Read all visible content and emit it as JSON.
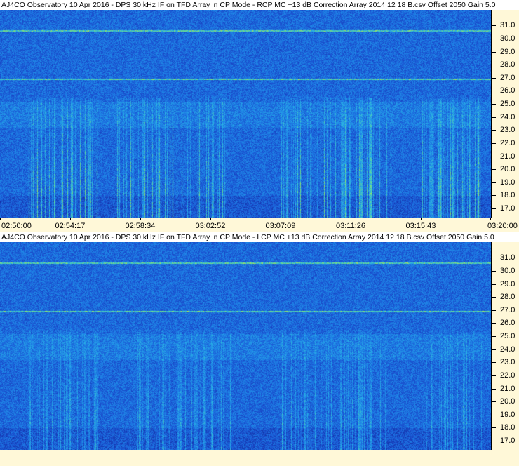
{
  "chart_data": [
    {
      "type": "heatmap",
      "title": "AJ4CO Observatory 10 Apr 2016 - DPS 30 kHz IF on TFD Array in CP Mode - RCP  MC +13 dB  Correction Array 2014 12 18 B.csv  Offset 2050  Gain 5.0",
      "polarization": "RCP",
      "ylim": [
        16.3,
        32.2
      ],
      "yticks": [
        31.0,
        30.0,
        29.0,
        28.0,
        27.0,
        26.0,
        25.0,
        24.0,
        23.0,
        22.0,
        21.0,
        20.0,
        19.0,
        18.0,
        17.0
      ],
      "yticklabels": [
        "31.0",
        "30.0",
        "29.0",
        "28.0",
        "27.0",
        "26.0",
        "25.0",
        "24.0",
        "23.0",
        "22.0",
        "21.0",
        "20.0",
        "19.0",
        "18.0",
        "17.0"
      ],
      "xticklabels": [
        "02:50:00",
        "02:54:17",
        "02:58:34",
        "03:02:52",
        "03:07:09",
        "03:11:26",
        "03:15:43",
        "03:20:00"
      ],
      "colormap": [
        "#10208f",
        "#1a4fcf",
        "#1e7fe6",
        "#29b3e6",
        "#6fe08a",
        "#e6e22e",
        "#ff8a1c",
        "#e0201a"
      ],
      "intensity": 1.0
    },
    {
      "type": "heatmap",
      "title": "AJ4CO Observatory 10 Apr 2016 - DPS 30 kHz IF on TFD Array in CP Mode - LCP  MC +13 dB  Correction Array 2014 12 18 B.csv  Offset 2050  Gain 5.0",
      "polarization": "LCP",
      "ylim": [
        16.3,
        32.2
      ],
      "yticks": [
        31.0,
        30.0,
        29.0,
        28.0,
        27.0,
        26.0,
        25.0,
        24.0,
        23.0,
        22.0,
        21.0,
        20.0,
        19.0,
        18.0,
        17.0
      ],
      "yticklabels": [
        "31.0",
        "30.0",
        "29.0",
        "28.0",
        "27.0",
        "26.0",
        "25.0",
        "24.0",
        "23.0",
        "22.0",
        "21.0",
        "20.0",
        "19.0",
        "18.0",
        "17.0"
      ],
      "xticklabels": [],
      "colormap": [
        "#10208f",
        "#1a4fcf",
        "#1e7fe6",
        "#29b3e6",
        "#6fe08a",
        "#e6e22e",
        "#ff8a1c",
        "#e0201a"
      ],
      "intensity": 0.6
    }
  ]
}
